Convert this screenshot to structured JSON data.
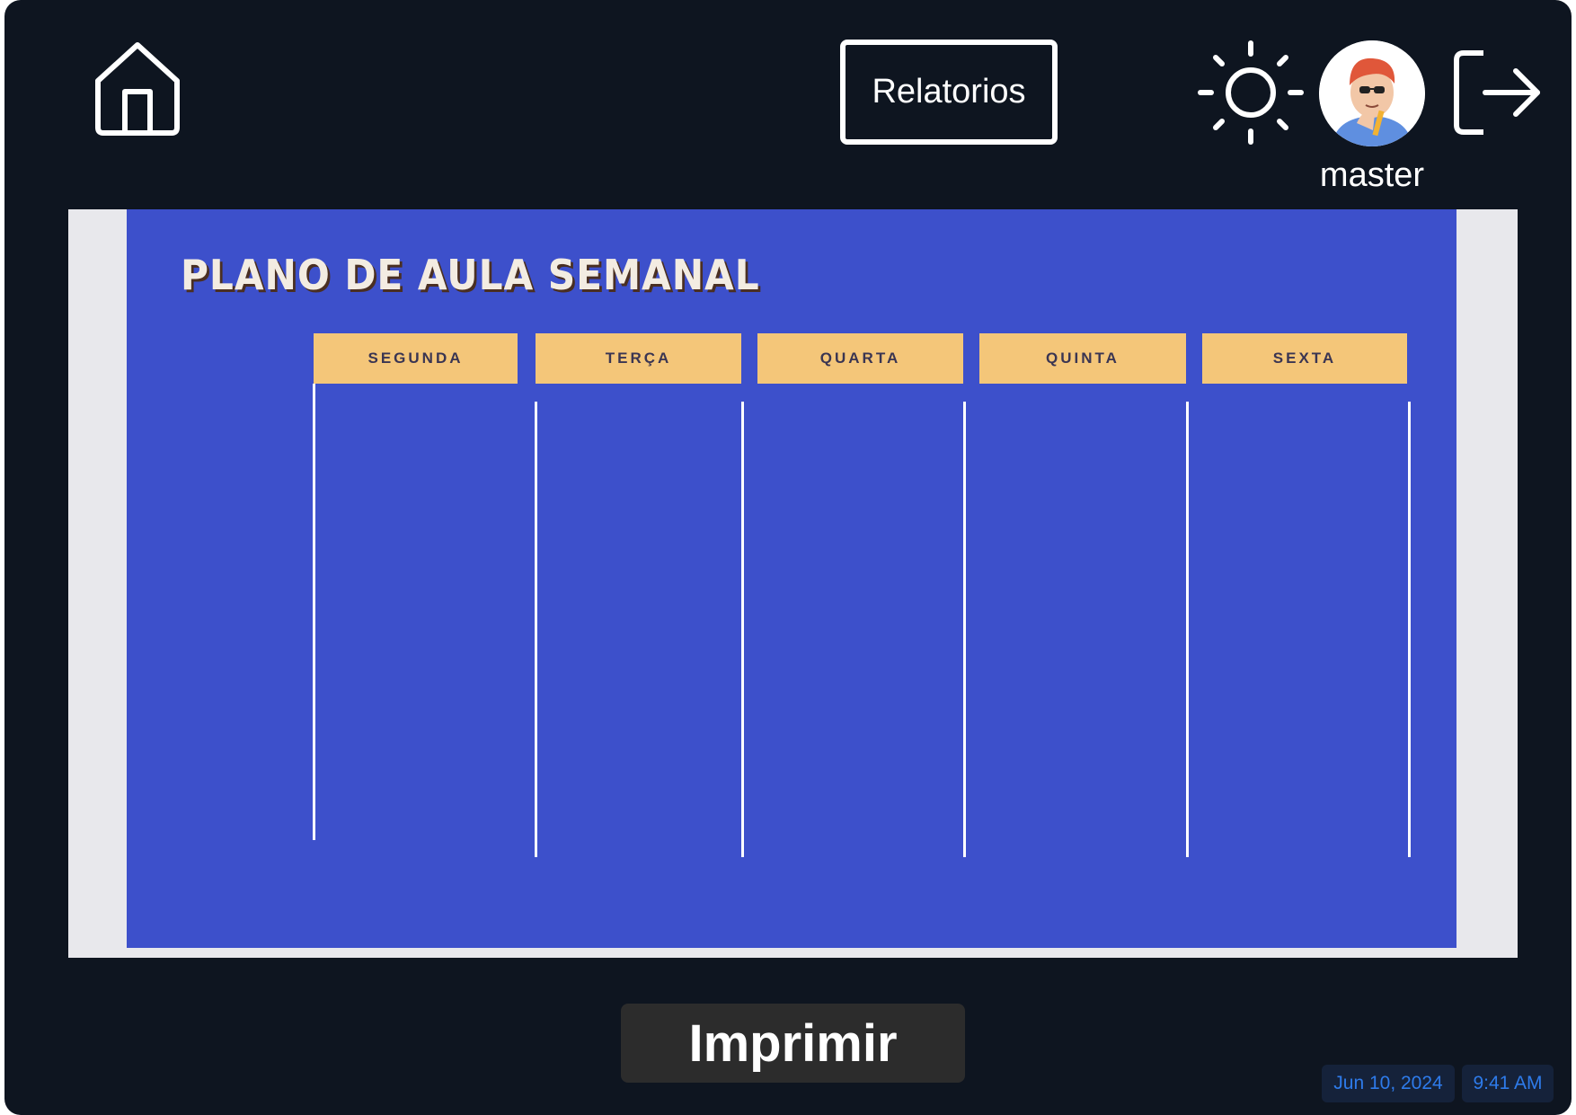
{
  "header": {
    "home_icon": "home-icon",
    "reports_label": "Relatorios",
    "theme_icon": "sun-icon",
    "user_name": "master",
    "logout_icon": "logout-icon"
  },
  "plan": {
    "title": "PLANO DE AULA SEMANAL",
    "days": [
      "SEGUNDA",
      "TERÇA",
      "QUARTA",
      "QUINTA",
      "SEXTA"
    ]
  },
  "footer": {
    "print_label": "Imprimir",
    "date": "Jun 10, 2024",
    "time": "9:41 AM"
  },
  "colors": {
    "app_background": "#0e1520",
    "slide_background": "#3d50cb",
    "day_header": "#f4c679",
    "status_text": "#2e7bea"
  }
}
